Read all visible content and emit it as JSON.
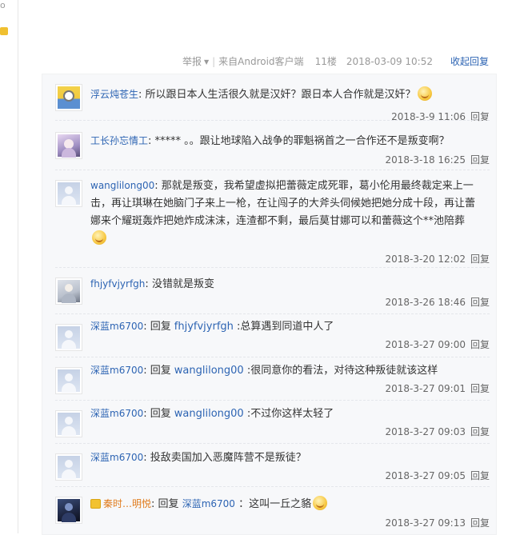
{
  "left_edge": {
    "glyph": "o"
  },
  "floor_bar": {
    "report": "举报",
    "source": "来自Android客户端",
    "floor": "11楼",
    "time": "2018-03-09 10:52",
    "collapse_reply": "收起回复"
  },
  "reply_word": "回复",
  "comments": [
    {
      "avatar": "minion",
      "user": "浮云炖苍生",
      "text": "所以跟日本人生活很久就是汉奸？跟日本人合作就是汉奸？",
      "emoji": true,
      "time": "2018-3-9 11:06",
      "reply_label": "回复"
    },
    {
      "avatar": "anime",
      "user": "⼯长孙忘情⼯",
      "text": "*****  。。跟让地球陷入战争的罪魁祸首之一合作还不是叛变啊？",
      "emoji": false,
      "time": "2018-3-18 16:25",
      "reply_label": "回复"
    },
    {
      "avatar": "default",
      "user": "wanglilong00",
      "text": "那就是叛变，我希望虚拟把蕾薇定成死罪，葛小伦用最终裁定来上一击，再让琪琳在她脑门子来上一枪，在让闯子的大斧头伺候她把她分成十段，再让蕾娜来个耀斑轰炸把她炸成沫沫，连渣都不剩，最后莫甘娜可以和蕾薇这个**池陪葬",
      "emoji": true,
      "time": "2018-3-20 12:02",
      "reply_label": "回复"
    },
    {
      "avatar": "girl",
      "user": "fhjyfvjyrfgh",
      "text": "没错就是叛变",
      "emoji": false,
      "time": "2018-3-26 18:46",
      "reply_label": "回复"
    },
    {
      "avatar": "default",
      "user": "深蓝m6700",
      "reply_to": "fhjyfvjyrfgh",
      "text": "总算遇到同道中人了",
      "emoji": false,
      "time": "2018-3-27 09:00",
      "reply_label": "回复"
    },
    {
      "avatar": "default",
      "user": "深蓝m6700",
      "reply_to": "wanglilong00",
      "text": "很同意你的看法，对待这种叛徒就该这样",
      "emoji": false,
      "time": "2018-3-27 09:01",
      "reply_label": "回复"
    },
    {
      "avatar": "default",
      "user": "深蓝m6700",
      "reply_to": "wanglilong00",
      "text": "不过你这样太轻了",
      "emoji": false,
      "time": "2018-3-27 09:03",
      "reply_label": "回复"
    },
    {
      "avatar": "default",
      "user": "深蓝m6700",
      "text": "投敌卖国加入恶魔阵营不是叛徒？",
      "emoji": false,
      "time": "2018-3-27 09:05",
      "reply_label": "回复"
    },
    {
      "avatar": "dark",
      "user": "秦时…明悦",
      "vip": true,
      "reply_to": "深蓝m6700",
      "text": "：这叫一丘之貉",
      "emoji": true,
      "time": "2018-3-27 09:13",
      "reply_label": "回复"
    }
  ],
  "colors": {
    "link": "#2d64b3",
    "gold_name": "#e07b1c",
    "panel_bg": "#f7f8fa"
  }
}
